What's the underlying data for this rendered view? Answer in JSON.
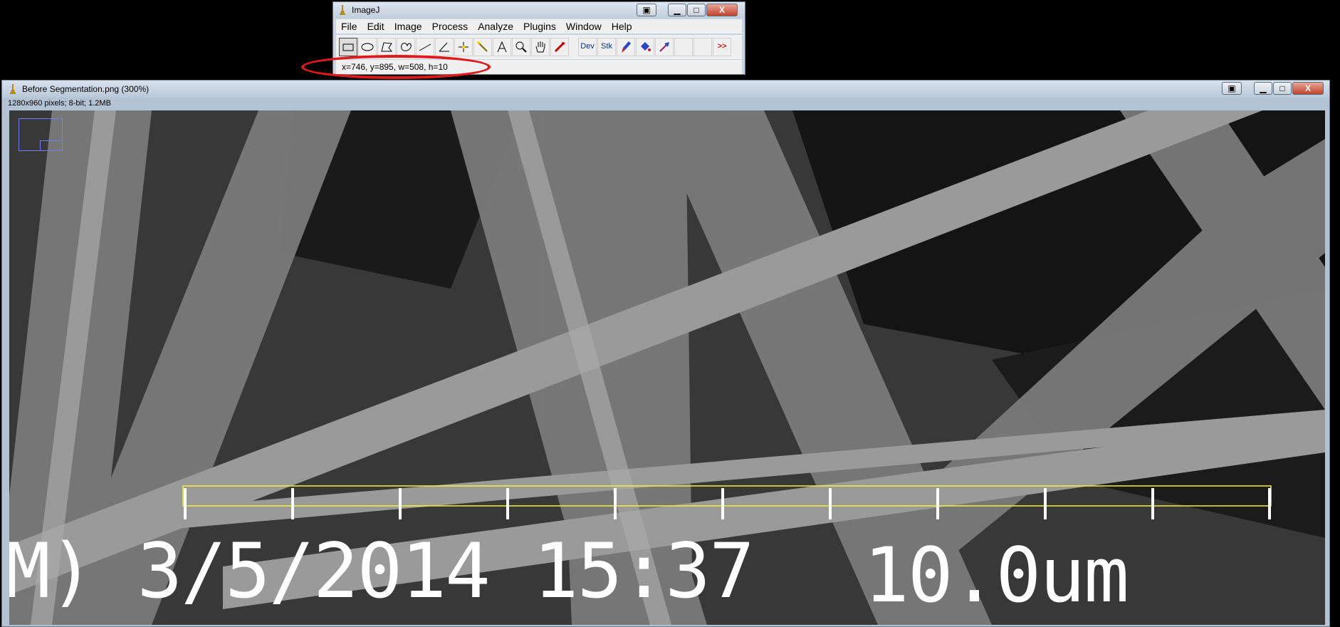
{
  "imagej_window": {
    "title": "ImageJ",
    "menu": [
      "File",
      "Edit",
      "Image",
      "Process",
      "Analyze",
      "Plugins",
      "Window",
      "Help"
    ],
    "tools": [
      {
        "name": "rectangle-tool"
      },
      {
        "name": "oval-tool"
      },
      {
        "name": "polygon-tool"
      },
      {
        "name": "freehand-tool"
      },
      {
        "name": "line-tool"
      },
      {
        "name": "angle-tool"
      },
      {
        "name": "point-tool"
      },
      {
        "name": "wand-tool"
      },
      {
        "name": "text-tool"
      },
      {
        "name": "magnifier-tool"
      },
      {
        "name": "hand-tool"
      },
      {
        "name": "color-picker-tool"
      },
      {
        "name": "dev-menu",
        "label": "Dev"
      },
      {
        "name": "stk-menu",
        "label": "Stk"
      },
      {
        "name": "brush-tool"
      },
      {
        "name": "flood-fill-tool"
      },
      {
        "name": "arrow-tool"
      },
      {
        "name": "empty-slot-1"
      },
      {
        "name": "empty-slot-2"
      },
      {
        "name": "more-tools",
        "label": ">>"
      }
    ],
    "status": "x=746, y=895, w=508, h=10",
    "window_controls": {
      "restore": "▣",
      "minimize": "▁",
      "maximize": "□",
      "close": "X"
    }
  },
  "image_window": {
    "title": "Before Segmentation.png (300%)",
    "info": "1280x960 pixels; 8-bit; 1.2MB",
    "overlay_datetime": "M) 3/5/2014 15:37",
    "overlay_scale": "10.0um"
  },
  "colors": {
    "selection": "#f2f23a",
    "annotation": "#e0191b",
    "navigator": "#7b7bff"
  }
}
